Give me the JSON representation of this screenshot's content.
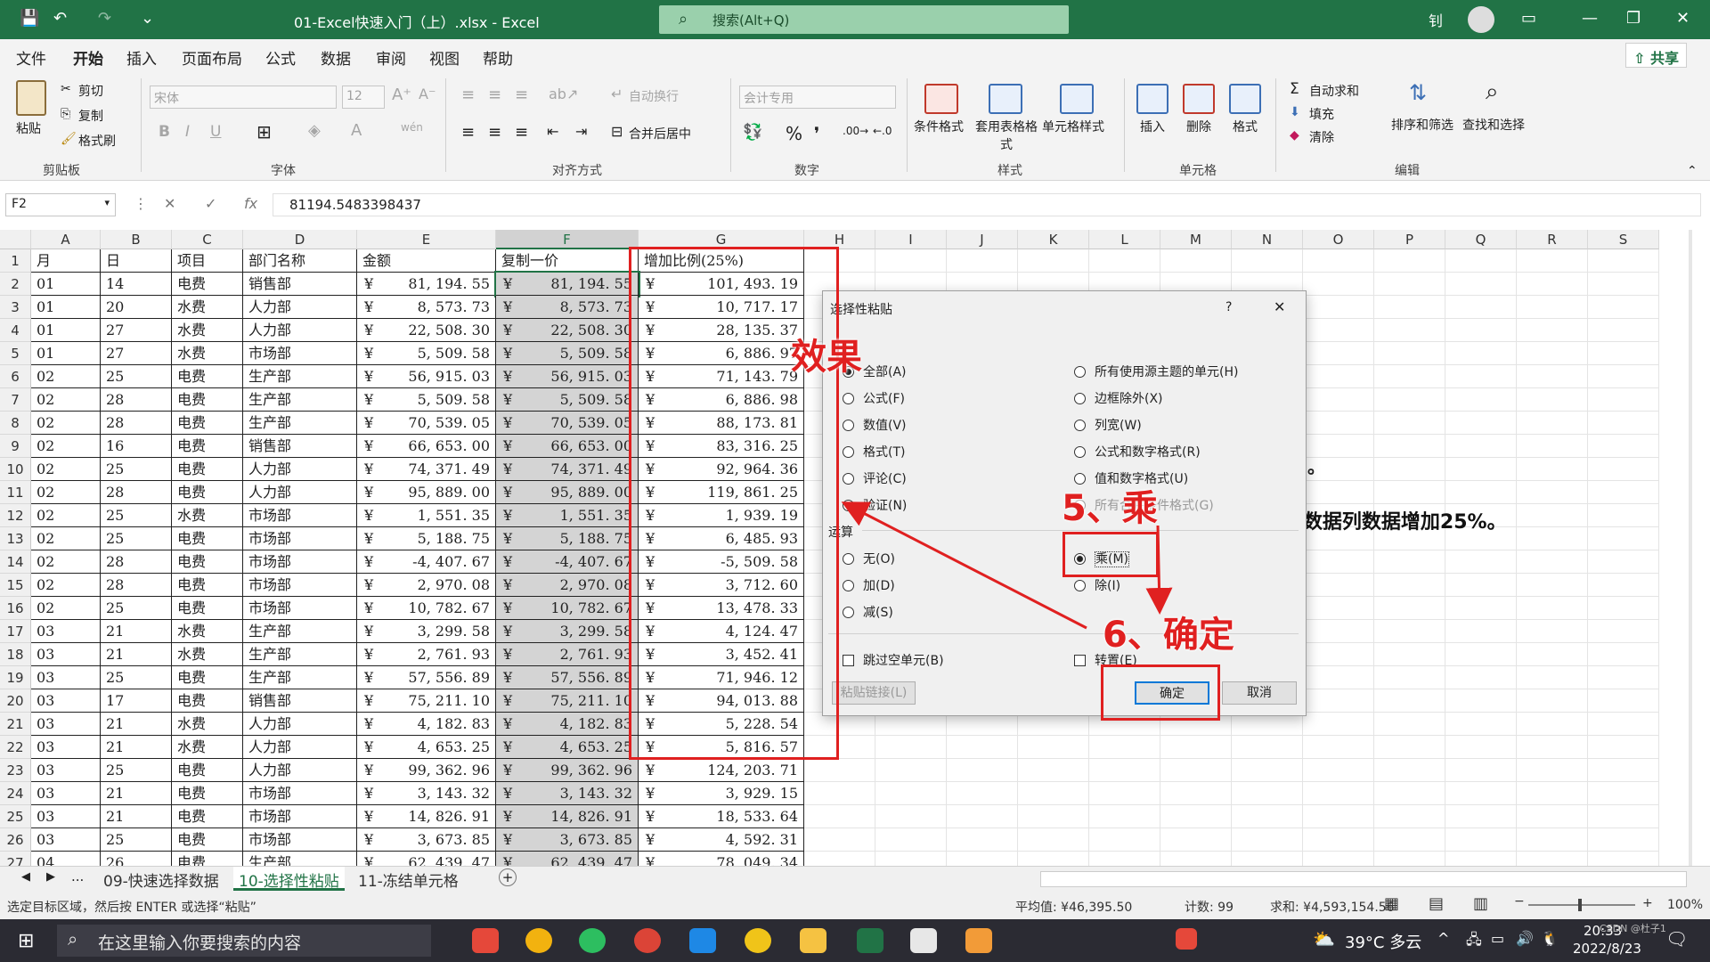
{
  "window": {
    "title": "01-Excel快速入门（上）.xlsx - Excel",
    "search_placeholder": "搜索(Alt+Q)",
    "user_initial": "钊"
  },
  "menu": {
    "items": [
      "文件",
      "开始",
      "插入",
      "页面布局",
      "公式",
      "数据",
      "审阅",
      "视图",
      "帮助"
    ],
    "share": "共享"
  },
  "ribbon": {
    "clipboard": {
      "paste": "粘贴",
      "cut": "剪切",
      "copy": "复制",
      "format_painter": "格式刷",
      "group": "剪贴板"
    },
    "font": {
      "name": "宋体",
      "size": "12",
      "group": "字体"
    },
    "alignment": {
      "wrap": "自动换行",
      "merge": "合并后居中",
      "group": "对齐方式"
    },
    "number": {
      "format": "会计专用",
      "group": "数字"
    },
    "styles": {
      "conditional": "条件格式",
      "table": "套用表格格式",
      "cell_styles": "单元格样式",
      "group": "样式"
    },
    "cells": {
      "insert": "插入",
      "delete": "删除",
      "format": "格式",
      "group": "单元格"
    },
    "editing": {
      "autosum": "自动求和",
      "fill": "填充",
      "clear": "清除",
      "sort": "排序和筛选",
      "find": "查找和选择",
      "group": "编辑"
    }
  },
  "formula_bar": {
    "name_box": "F2",
    "value": "81194.5483398437"
  },
  "columns": [
    "A",
    "B",
    "C",
    "D",
    "E",
    "F",
    "G",
    "H",
    "I",
    "J",
    "K",
    "L",
    "M",
    "N",
    "O",
    "P",
    "Q",
    "R",
    "S"
  ],
  "headers": [
    "月",
    "日",
    "项目",
    "部门名称",
    "金额",
    "复制一价",
    "增加比例(25%)"
  ],
  "currency": "¥",
  "rows": [
    [
      "01",
      "14",
      "电费",
      "销售部",
      "81, 194. 55",
      "81, 194. 55",
      "101, 493. 19"
    ],
    [
      "01",
      "20",
      "水费",
      "人力部",
      "8, 573. 73",
      "8, 573. 73",
      "10, 717. 17"
    ],
    [
      "01",
      "27",
      "水费",
      "人力部",
      "22, 508. 30",
      "22, 508. 30",
      "28, 135. 37"
    ],
    [
      "01",
      "27",
      "水费",
      "市场部",
      "5, 509. 58",
      "5, 509. 58",
      "6, 886. 97"
    ],
    [
      "02",
      "25",
      "电费",
      "生产部",
      "56, 915. 03",
      "56, 915. 03",
      "71, 143. 79"
    ],
    [
      "02",
      "28",
      "电费",
      "生产部",
      "5, 509. 58",
      "5, 509. 58",
      "6, 886. 98"
    ],
    [
      "02",
      "28",
      "电费",
      "生产部",
      "70, 539. 05",
      "70, 539. 05",
      "88, 173. 81"
    ],
    [
      "02",
      "16",
      "电费",
      "销售部",
      "66, 653. 00",
      "66, 653. 00",
      "83, 316. 25"
    ],
    [
      "02",
      "25",
      "电费",
      "人力部",
      "74, 371. 49",
      "74, 371. 49",
      "92, 964. 36"
    ],
    [
      "02",
      "28",
      "电费",
      "人力部",
      "95, 889. 00",
      "95, 889. 00",
      "119, 861. 25"
    ],
    [
      "02",
      "25",
      "水费",
      "市场部",
      "1, 551. 35",
      "1, 551. 35",
      "1, 939. 19"
    ],
    [
      "02",
      "25",
      "电费",
      "市场部",
      "5, 188. 75",
      "5, 188. 75",
      "6, 485. 93"
    ],
    [
      "02",
      "28",
      "电费",
      "市场部",
      "-4, 407. 67",
      "-4, 407. 67",
      "-5, 509. 58"
    ],
    [
      "02",
      "28",
      "电费",
      "市场部",
      "2, 970. 08",
      "2, 970. 08",
      "3, 712. 60"
    ],
    [
      "02",
      "25",
      "电费",
      "市场部",
      "10, 782. 67",
      "10, 782. 67",
      "13, 478. 33"
    ],
    [
      "03",
      "21",
      "水费",
      "生产部",
      "3, 299. 58",
      "3, 299. 58",
      "4, 124. 47"
    ],
    [
      "03",
      "21",
      "水费",
      "生产部",
      "2, 761. 93",
      "2, 761. 93",
      "3, 452. 41"
    ],
    [
      "03",
      "25",
      "电费",
      "生产部",
      "57, 556. 89",
      "57, 556. 89",
      "71, 946. 12"
    ],
    [
      "03",
      "17",
      "电费",
      "销售部",
      "75, 211. 10",
      "75, 211. 10",
      "94, 013. 88"
    ],
    [
      "03",
      "21",
      "水费",
      "人力部",
      "4, 182. 83",
      "4, 182. 83",
      "5, 228. 54"
    ],
    [
      "03",
      "21",
      "水费",
      "人力部",
      "4, 653. 25",
      "4, 653. 25",
      "5, 816. 57"
    ],
    [
      "03",
      "25",
      "电费",
      "人力部",
      "99, 362. 96",
      "99, 362. 96",
      "124, 203. 71"
    ],
    [
      "03",
      "21",
      "电费",
      "市场部",
      "3, 143. 32",
      "3, 143. 32",
      "3, 929. 15"
    ],
    [
      "03",
      "21",
      "电费",
      "市场部",
      "14, 826. 91",
      "14, 826. 91",
      "18, 533. 64"
    ],
    [
      "03",
      "25",
      "电费",
      "市场部",
      "3, 673. 85",
      "3, 673. 85",
      "4, 592. 31"
    ],
    [
      "04",
      "26",
      "电费",
      "生产部",
      "62, 439. 47",
      "62, 439. 47",
      "78, 049. 34"
    ]
  ],
  "requirement_text": "要求：使用选择性粘贴方法在增加比例列实现“金额”数据列数据增加25%。",
  "stray_mark": "。",
  "dialog": {
    "title": "选择性粘贴",
    "help": "?",
    "close": "✕",
    "paste_left": [
      "全部(A)",
      "公式(F)",
      "数值(V)",
      "格式(T)",
      "评论(C)",
      "验证(N)"
    ],
    "paste_right": [
      "所有使用源主题的单元(H)",
      "边框除外(X)",
      "列宽(W)",
      "公式和数字格式(R)",
      "值和数字格式(U)",
      "所有合并条件格式(G)"
    ],
    "operation_label": "运算",
    "op_left": [
      "无(O)",
      "加(D)",
      "减(S)"
    ],
    "op_right": [
      "乘(M)",
      "除(I)"
    ],
    "skip_blanks": "跳过空单元(B)",
    "transpose": "转置(E)",
    "paste_link": "粘贴链接(L)",
    "ok": "确定",
    "cancel": "取消"
  },
  "annotations": {
    "effect": "效果",
    "step5": "5、乘",
    "step6": "6、确定"
  },
  "sheet_tabs": [
    "09-快速选择数据",
    "10-选择性粘贴",
    "11-冻结单元格"
  ],
  "sheet_nav": "...",
  "status": {
    "message": "选定目标区域，然后按 ENTER 或选择“粘贴”",
    "average": "平均值: ¥46,395.50",
    "count": "计数: 99",
    "sum": "求和: ¥4,593,154.56",
    "zoom": "100%"
  },
  "taskbar": {
    "search": "在这里输入你要搜索的内容",
    "weather": "39°C 多云",
    "time": "20:33",
    "date": "2022/8/23",
    "watermark": "CSDN @杜子1"
  }
}
